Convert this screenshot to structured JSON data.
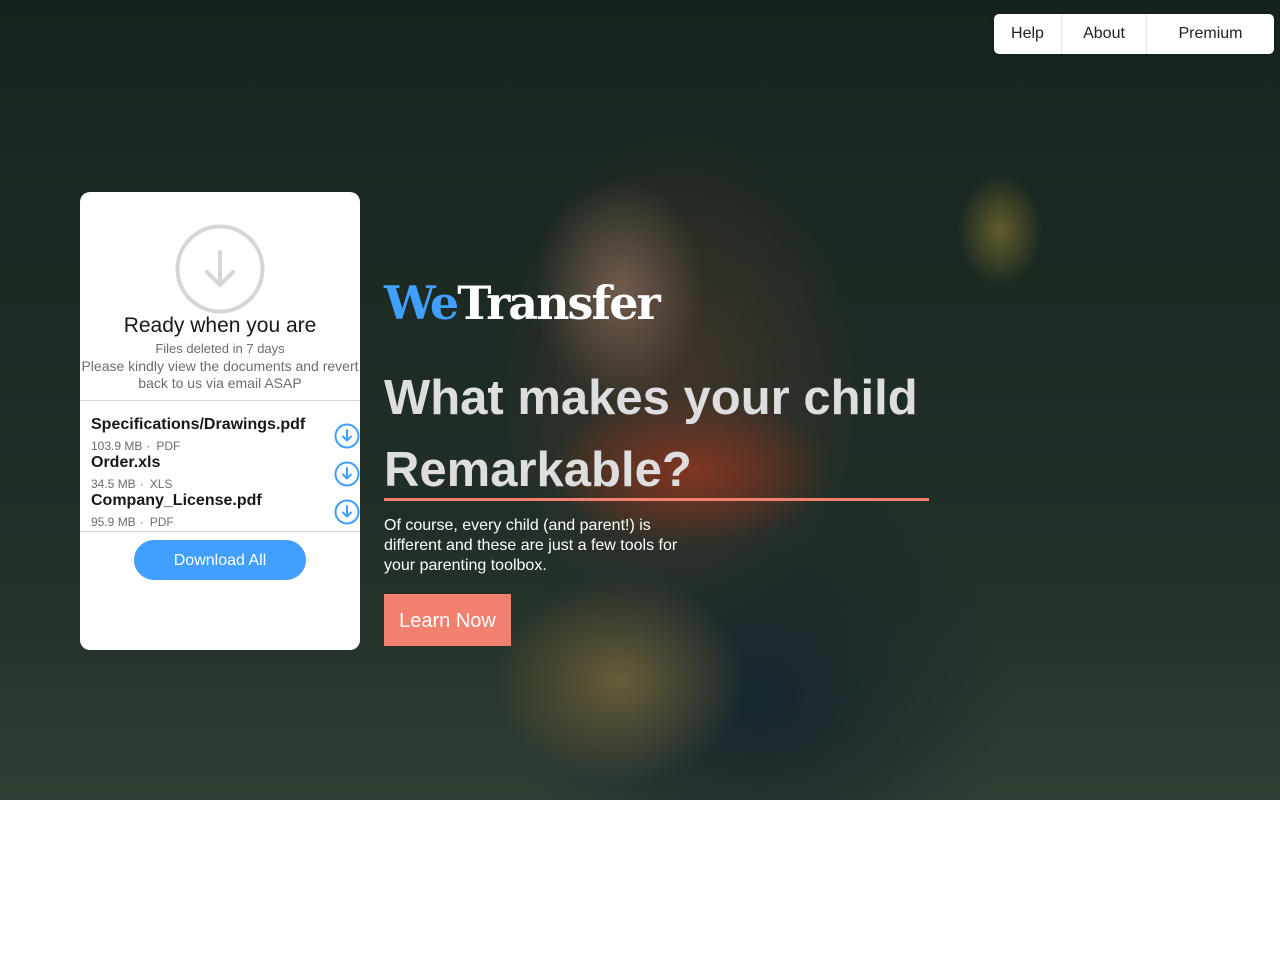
{
  "nav": {
    "help": "Help",
    "about": "About",
    "premium": "Premium"
  },
  "panel": {
    "title": "Ready when you are",
    "expiry": "Files deleted in 7 days",
    "message": "Please kindly view the documents and revert back to us via email ASAP",
    "files": [
      {
        "name": "Specifications/Drawings.pdf",
        "size": "103.9 MB",
        "type": "PDF"
      },
      {
        "name": "Order.xls",
        "size": "34.5 MB",
        "type": "XLS"
      },
      {
        "name": "Company_License.pdf",
        "size": "95.9 MB",
        "type": "PDF"
      }
    ],
    "meta_separator": "·",
    "download_all": "Download All"
  },
  "brand": {
    "part1": "We",
    "part2": "Transfer"
  },
  "hero": {
    "headline": "What makes your child Remarkable?",
    "subtext": "Of course, every child (and parent!) is different and these are just a few tools for your parenting toolbox.",
    "cta": "Learn Now"
  },
  "colors": {
    "accent_blue": "#409fff",
    "accent_coral": "#f2806e",
    "icon_grey": "#d4d7d9"
  },
  "icons": {
    "main": "download-arrow-circle-icon",
    "file": "download-circle-icon"
  }
}
